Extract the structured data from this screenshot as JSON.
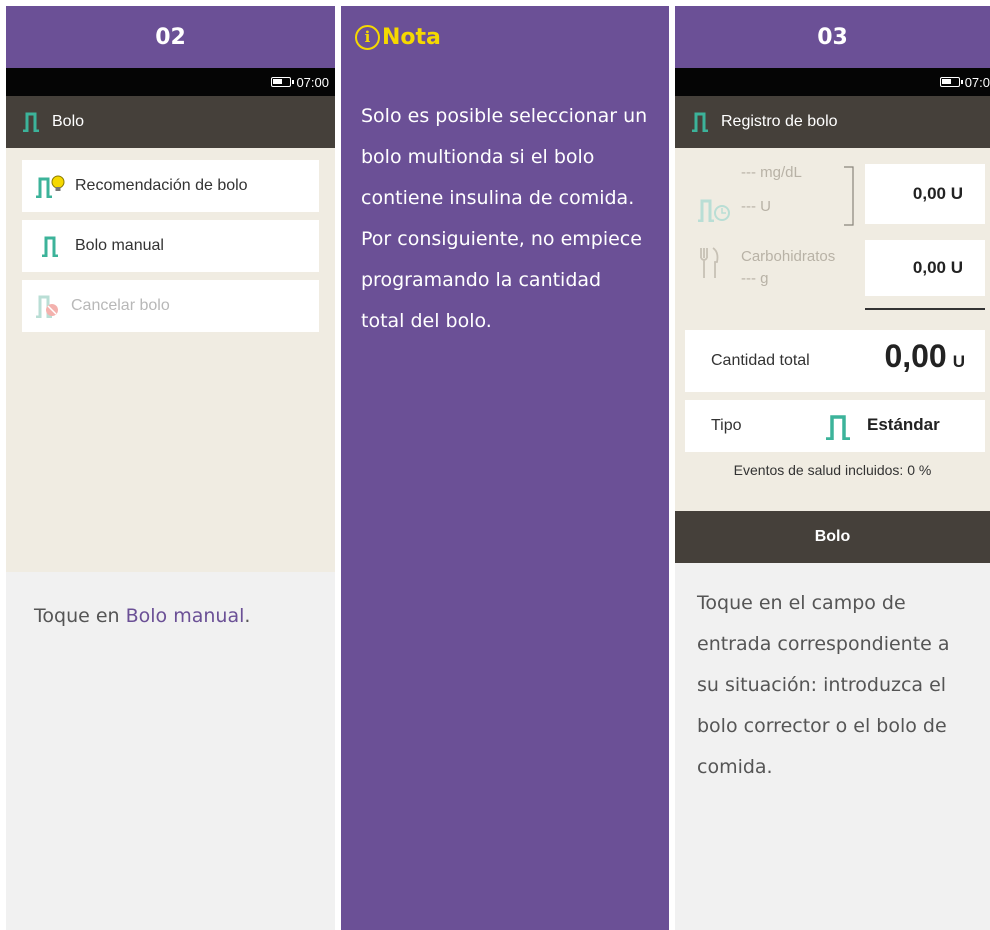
{
  "step1": {
    "number": "02",
    "status_time": "07:00",
    "app_title": "Bolo",
    "menu": [
      {
        "label": "Recomendación de bolo",
        "icon": "bolus-advice-icon",
        "enabled": true
      },
      {
        "label": "Bolo manual",
        "icon": "bolus-icon",
        "enabled": true
      },
      {
        "label": "Cancelar bolo",
        "icon": "cancel-bolus-icon",
        "enabled": false
      }
    ],
    "caption_prefix": "Toque en ",
    "caption_link": "Bolo manual",
    "caption_suffix": "."
  },
  "note": {
    "title": "Nota",
    "info_glyph": "i",
    "text": "Solo es posible seleccionar un bolo multionda si el bolo contiene insulina de comida. Por consiguiente, no empiece programando la cantidad total del bolo."
  },
  "step2": {
    "number": "03",
    "status_time": "07:0",
    "app_title": "Registro de bolo",
    "bg_placeholder": "--- mg/dL",
    "correction_placeholder": "--- U",
    "correction_value": "0,00 U",
    "carbs_label": "Carbohidratos",
    "carbs_placeholder": "--- g",
    "carbs_value": "0,00 U",
    "total_label": "Cantidad total",
    "total_value": "0,00",
    "total_unit": "U",
    "type_label": "Tipo",
    "type_value": "Estándar",
    "health_events": "Eventos de salud incluidos: 0 %",
    "bolus_button": "Bolo",
    "caption": "Toque en el campo de entrada correspondiente a su situación: introduzca el bolo corrector o el bolo de comida."
  },
  "colors": {
    "header_purple": "#6b5096",
    "note_yellow": "#f5d800",
    "bolus_green": "#3cb39a",
    "screen_bg": "#f0ece2",
    "appbar": "#45403a"
  }
}
